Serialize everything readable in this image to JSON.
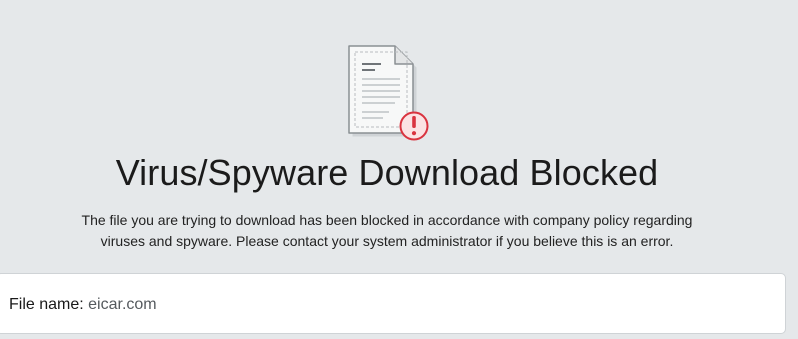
{
  "page": {
    "title": "Virus/Spyware Download Blocked",
    "message_line1": "The file you are trying to download has been blocked in accordance with company policy regarding",
    "message_line2": "viruses and spyware. Please contact your system administrator if you believe this is an error.",
    "icon": "blocked-document-icon",
    "alert_badge_icon": "exclamation-alert-icon"
  },
  "file_info": {
    "label": "File name:",
    "value": "eicar.com"
  },
  "colors": {
    "background": "#e5e8ea",
    "alert_red": "#d9333f",
    "alert_fill": "#fbe3e4",
    "card_background": "#ffffff"
  }
}
